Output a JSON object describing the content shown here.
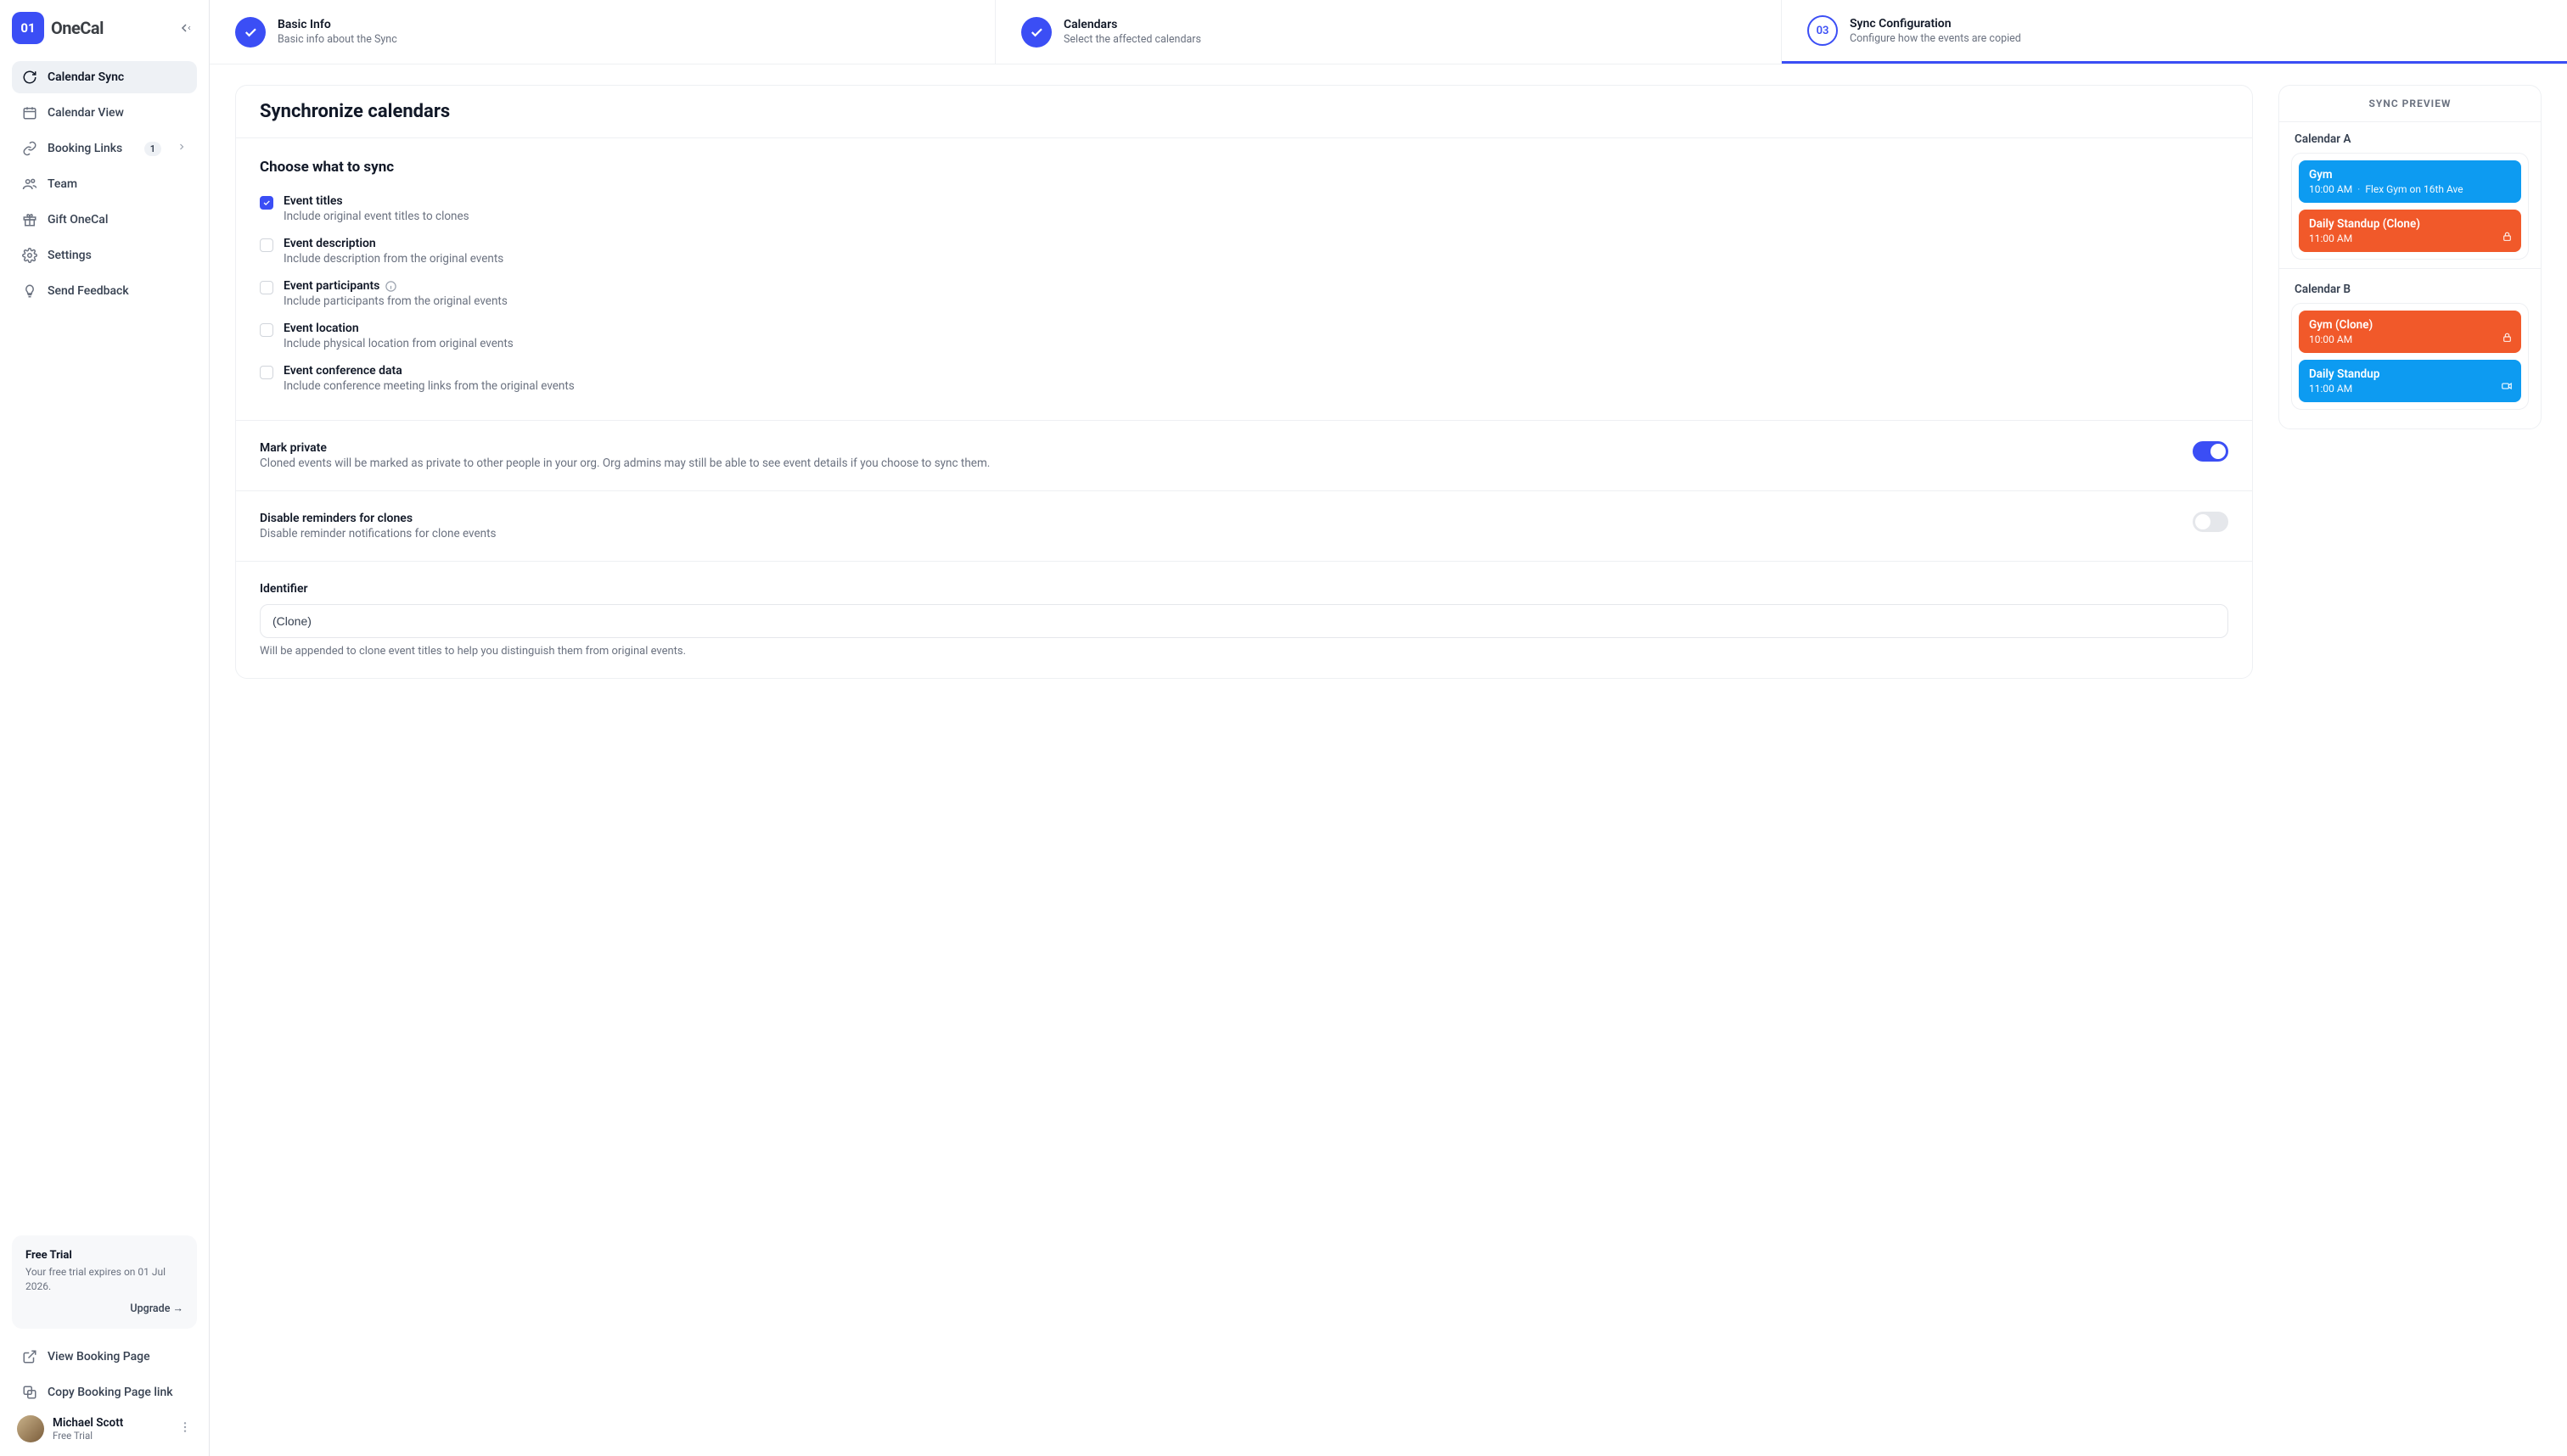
{
  "brand": {
    "logo_text": "OneCal",
    "logo_short": "01"
  },
  "sidebar": {
    "items": [
      {
        "label": "Calendar Sync"
      },
      {
        "label": "Calendar View"
      },
      {
        "label": "Booking Links",
        "badge": "1"
      },
      {
        "label": "Team"
      },
      {
        "label": "Gift OneCal"
      },
      {
        "label": "Settings"
      },
      {
        "label": "Send Feedback"
      }
    ],
    "footer": [
      {
        "label": "View Booking Page"
      },
      {
        "label": "Copy Booking Page link"
      }
    ],
    "trial": {
      "title": "Free Trial",
      "text": "Your free trial expires on 01 Jul 2026.",
      "cta": "Upgrade →"
    },
    "user": {
      "name": "Michael Scott",
      "plan": "Free Trial"
    }
  },
  "stepper": {
    "s1": {
      "title": "Basic Info",
      "sub": "Basic info about the Sync"
    },
    "s2": {
      "title": "Calendars",
      "sub": "Select the affected calendars"
    },
    "s3": {
      "num": "03",
      "title": "Sync Configuration",
      "sub": "Configure how the events are copied"
    }
  },
  "left": {
    "heading": "Synchronize calendars",
    "choose_title": "Choose what to sync",
    "opts": {
      "titles": {
        "label": "Event titles",
        "sub": "Include original event titles to clones"
      },
      "description": {
        "label": "Event description",
        "sub": "Include description from the original events"
      },
      "participants": {
        "label": "Event participants",
        "sub": "Include participants from the original events"
      },
      "location": {
        "label": "Event location",
        "sub": "Include physical location from original events"
      },
      "conference": {
        "label": "Event conference data",
        "sub": "Include conference meeting links from the original events"
      }
    },
    "mark_private": {
      "title": "Mark private",
      "sub": "Cloned events will be marked as private to other people in your org. Org admins may still be able to see event details if you choose to sync them."
    },
    "reminders": {
      "title": "Disable reminders for clones",
      "sub": "Disable reminder notifications for clone events"
    },
    "identifier": {
      "label": "Identifier",
      "value": "(Clone)",
      "help": "Will be appended to clone event titles to help you distinguish them from original events."
    }
  },
  "preview": {
    "heading": "SYNC PREVIEW",
    "calA": "Calendar A",
    "calB": "Calendar B",
    "a": {
      "gym": {
        "title": "Gym",
        "time": "10:00 AM",
        "loc": "Flex Gym on 16th Ave"
      },
      "stand": {
        "title": "Daily Standup (Clone)",
        "time": "11:00 AM"
      }
    },
    "b": {
      "gym": {
        "title": "Gym (Clone)",
        "time": "10:00 AM"
      },
      "stand": {
        "title": "Daily Standup",
        "time": "11:00 AM"
      }
    }
  }
}
